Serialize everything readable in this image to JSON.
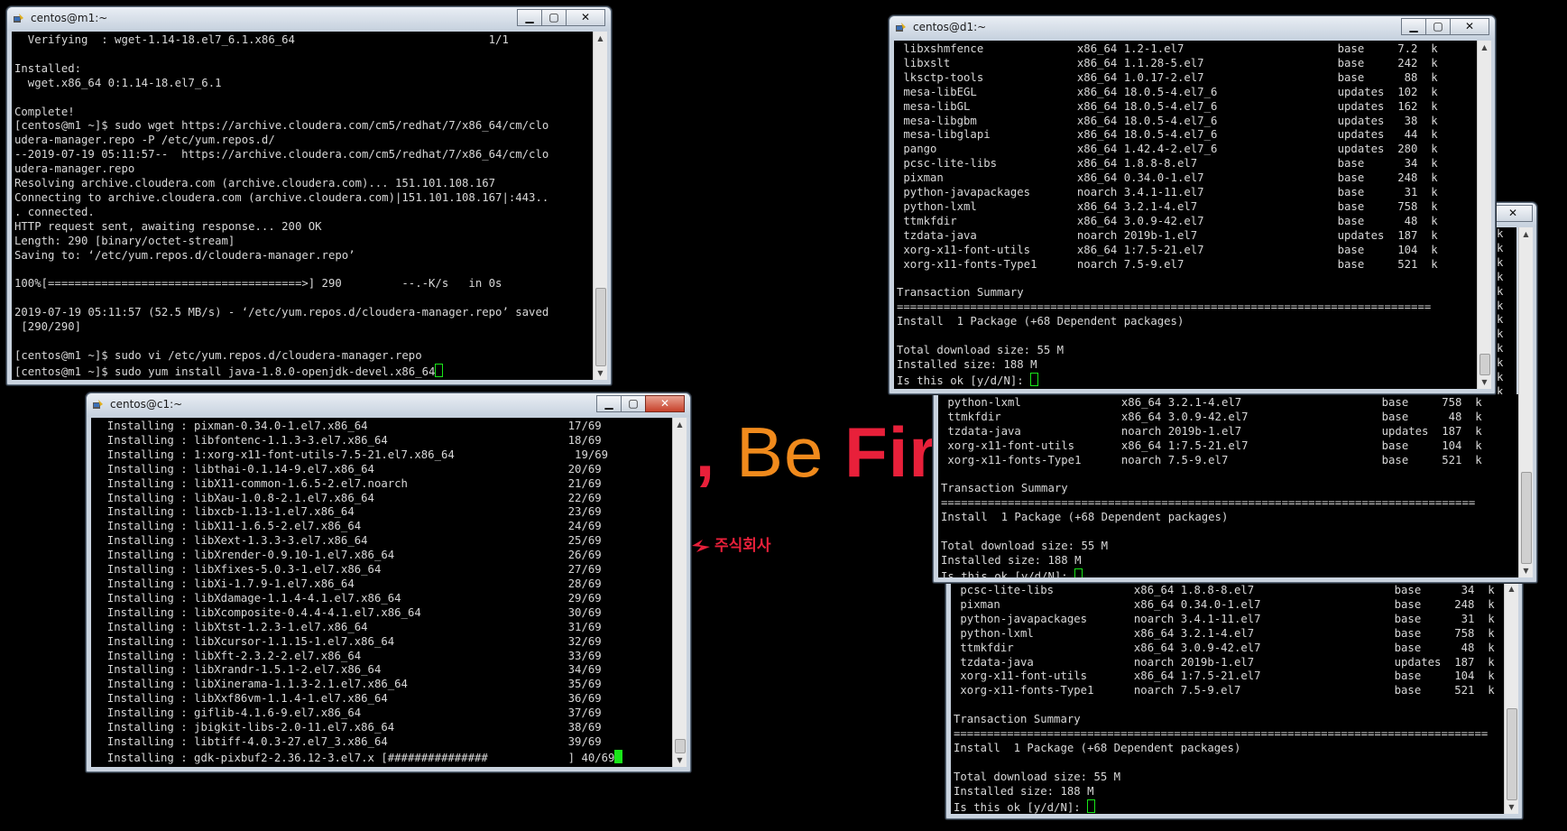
{
  "wallpaper": {
    "slogan_a": "l,",
    "slogan_b": " Be ",
    "slogan_c": "Fir",
    "logo_text": "주식회사",
    "colors": {
      "red": "#e8203a",
      "orange": "#f08a1c"
    }
  },
  "icons": {
    "putty": "putty-icon",
    "minimize": "minimize-icon",
    "maximize": "maximize-icon",
    "close": "close-icon",
    "scroll_up": "scroll-up-icon",
    "scroll_down": "scroll-down-icon"
  },
  "terminal_colors": {
    "text": "#d8d8d8",
    "cursor": "#19e619"
  },
  "window_m1": {
    "title": "centos@m1:~",
    "lines": [
      "  Verifying  : wget-1.14-18.el7_6.1.x86_64                             1/1",
      "",
      "Installed:",
      "  wget.x86_64 0:1.14-18.el7_6.1",
      "",
      "Complete!",
      "[centos@m1 ~]$ sudo wget https://archive.cloudera.com/cm5/redhat/7/x86_64/cm/clo",
      "udera-manager.repo -P /etc/yum.repos.d/",
      "--2019-07-19 05:11:57--  https://archive.cloudera.com/cm5/redhat/7/x86_64/cm/clo",
      "udera-manager.repo",
      "Resolving archive.cloudera.com (archive.cloudera.com)... 151.101.108.167",
      "Connecting to archive.cloudera.com (archive.cloudera.com)|151.101.108.167|:443..",
      ". connected.",
      "HTTP request sent, awaiting response... 200 OK",
      "Length: 290 [binary/octet-stream]",
      "Saving to: ‘/etc/yum.repos.d/cloudera-manager.repo’",
      "",
      "100%[======================================>] 290         --.-K/s   in 0s",
      "",
      "2019-07-19 05:11:57 (52.5 MB/s) - ‘/etc/yum.repos.d/cloudera-manager.repo’ saved",
      " [290/290]",
      "",
      "[centos@m1 ~]$ sudo vi /etc/yum.repos.d/cloudera-manager.repo"
    ],
    "prompt_line": "[centos@m1 ~]$ sudo yum install java-1.8.0-openjdk-devel.x86_64"
  },
  "window_c1": {
    "title": "centos@c1:~",
    "lines": [
      "  Installing : pixman-0.34.0-1.el7.x86_64                              17/69",
      "  Installing : libfontenc-1.1.3-3.el7.x86_64                           18/69",
      "  Installing : 1:xorg-x11-font-utils-7.5-21.el7.x86_64                  19/69",
      "  Installing : libthai-0.1.14-9.el7.x86_64                             20/69",
      "  Installing : libX11-common-1.6.5-2.el7.noarch                        21/69",
      "  Installing : libXau-1.0.8-2.1.el7.x86_64                             22/69",
      "  Installing : libxcb-1.13-1.el7.x86_64                                23/69",
      "  Installing : libX11-1.6.5-2.el7.x86_64                               24/69",
      "  Installing : libXext-1.3.3-3.el7.x86_64                              25/69",
      "  Installing : libXrender-0.9.10-1.el7.x86_64                          26/69",
      "  Installing : libXfixes-5.0.3-1.el7.x86_64                            27/69",
      "  Installing : libXi-1.7.9-1.el7.x86_64                                28/69",
      "  Installing : libXdamage-1.1.4-4.1.el7.x86_64                         29/69",
      "  Installing : libXcomposite-0.4.4-4.1.el7.x86_64                      30/69",
      "  Installing : libXtst-1.2.3-1.el7.x86_64                              31/69",
      "  Installing : libXcursor-1.1.15-1.el7.x86_64                          32/69",
      "  Installing : libXft-2.3.2-2.el7.x86_64                               33/69",
      "  Installing : libXrandr-1.5.1-2.el7.x86_64                            34/69",
      "  Installing : libXinerama-1.1.3-2.1.el7.x86_64                        35/69",
      "  Installing : libXxf86vm-1.1.4-1.el7.x86_64                           36/69",
      "  Installing : giflib-4.1.6-9.el7.x86_64                               37/69",
      "  Installing : jbigkit-libs-2.0-11.el7.x86_64                          38/69",
      "  Installing : libtiff-4.0.3-27.el7_3.x86_64                           39/69"
    ],
    "last_line": "  Installing : gdk-pixbuf2-2.36.12-3.el7.x [###############            ] 40/69"
  },
  "window_d1": {
    "title": "centos@d1:~",
    "lines": [
      " libxshmfence              x86_64 1.2-1.el7                       base     7.2  k",
      " libxslt                   x86_64 1.1.28-5.el7                    base     242  k",
      " lksctp-tools              x86_64 1.0.17-2.el7                    base      88  k",
      " mesa-libEGL               x86_64 18.0.5-4.el7_6                  updates  102  k",
      " mesa-libGL                x86_64 18.0.5-4.el7_6                  updates  162  k",
      " mesa-libgbm               x86_64 18.0.5-4.el7_6                  updates   38  k",
      " mesa-libglapi             x86_64 18.0.5-4.el7_6                  updates   44  k",
      " pango                     x86_64 1.42.4-2.el7_6                  updates  280  k",
      " pcsc-lite-libs            x86_64 1.8.8-8.el7                     base      34  k",
      " pixman                    x86_64 0.34.0-1.el7                    base     248  k",
      " python-javapackages       noarch 3.4.1-11.el7                    base      31  k",
      " python-lxml               x86_64 3.2.1-4.el7                     base     758  k",
      " ttmkfdir                  x86_64 3.0.9-42.el7                    base      48  k",
      " tzdata-java               noarch 2019b-1.el7                     updates  187  k",
      " xorg-x11-font-utils       x86_64 1:7.5-21.el7                    base     104  k",
      " xorg-x11-fonts-Type1      noarch 7.5-9.el7                       base     521  k",
      "",
      "Transaction Summary",
      "================================================================================",
      "Install  1 Package (+68 Dependent packages)",
      "",
      "Total download size: 55 M",
      "Installed size: 188 M"
    ],
    "prompt_line": "Is this ok [y/d/N]: "
  },
  "window_d2": {
    "lines": [
      " python-lxml               x86_64 3.2.1-4.el7                     base     758  k",
      " ttmkfdir                  x86_64 3.0.9-42.el7                    base      48  k",
      " tzdata-java               noarch 2019b-1.el7                     updates  187  k",
      " xorg-x11-font-utils       x86_64 1:7.5-21.el7                    base     104  k",
      " xorg-x11-fonts-Type1      noarch 7.5-9.el7                       base     521  k",
      "",
      "Transaction Summary",
      "================================================================================",
      "Install  1 Package (+68 Dependent packages)",
      "",
      "Total download size: 55 M",
      "Installed size: 188 M"
    ],
    "prompt_line": "Is this ok [y/d/N]: ",
    "edge_marks": [
      "k",
      "k",
      "k",
      "k",
      "k",
      "k",
      "k",
      "k",
      "k",
      "k",
      "k",
      "k",
      "k",
      "k",
      "k",
      "k",
      "k",
      "k",
      "k",
      "k",
      "k"
    ]
  },
  "window_d3": {
    "lines": [
      " pcsc-lite-libs            x86_64 1.8.8-8.el7                     base      34  k",
      " pixman                    x86_64 0.34.0-1.el7                    base     248  k",
      " python-javapackages       noarch 3.4.1-11.el7                    base      31  k",
      " python-lxml               x86_64 3.2.1-4.el7                     base     758  k",
      " ttmkfdir                  x86_64 3.0.9-42.el7                    base      48  k",
      " tzdata-java               noarch 2019b-1.el7                     updates  187  k",
      " xorg-x11-font-utils       x86_64 1:7.5-21.el7                    base     104  k",
      " xorg-x11-fonts-Type1      noarch 7.5-9.el7                       base     521  k",
      "",
      "Transaction Summary",
      "================================================================================",
      "Install  1 Package (+68 Dependent packages)",
      "",
      "Total download size: 55 M",
      "Installed size: 188 M"
    ],
    "prompt_line": "Is this ok [y/d/N]: "
  }
}
